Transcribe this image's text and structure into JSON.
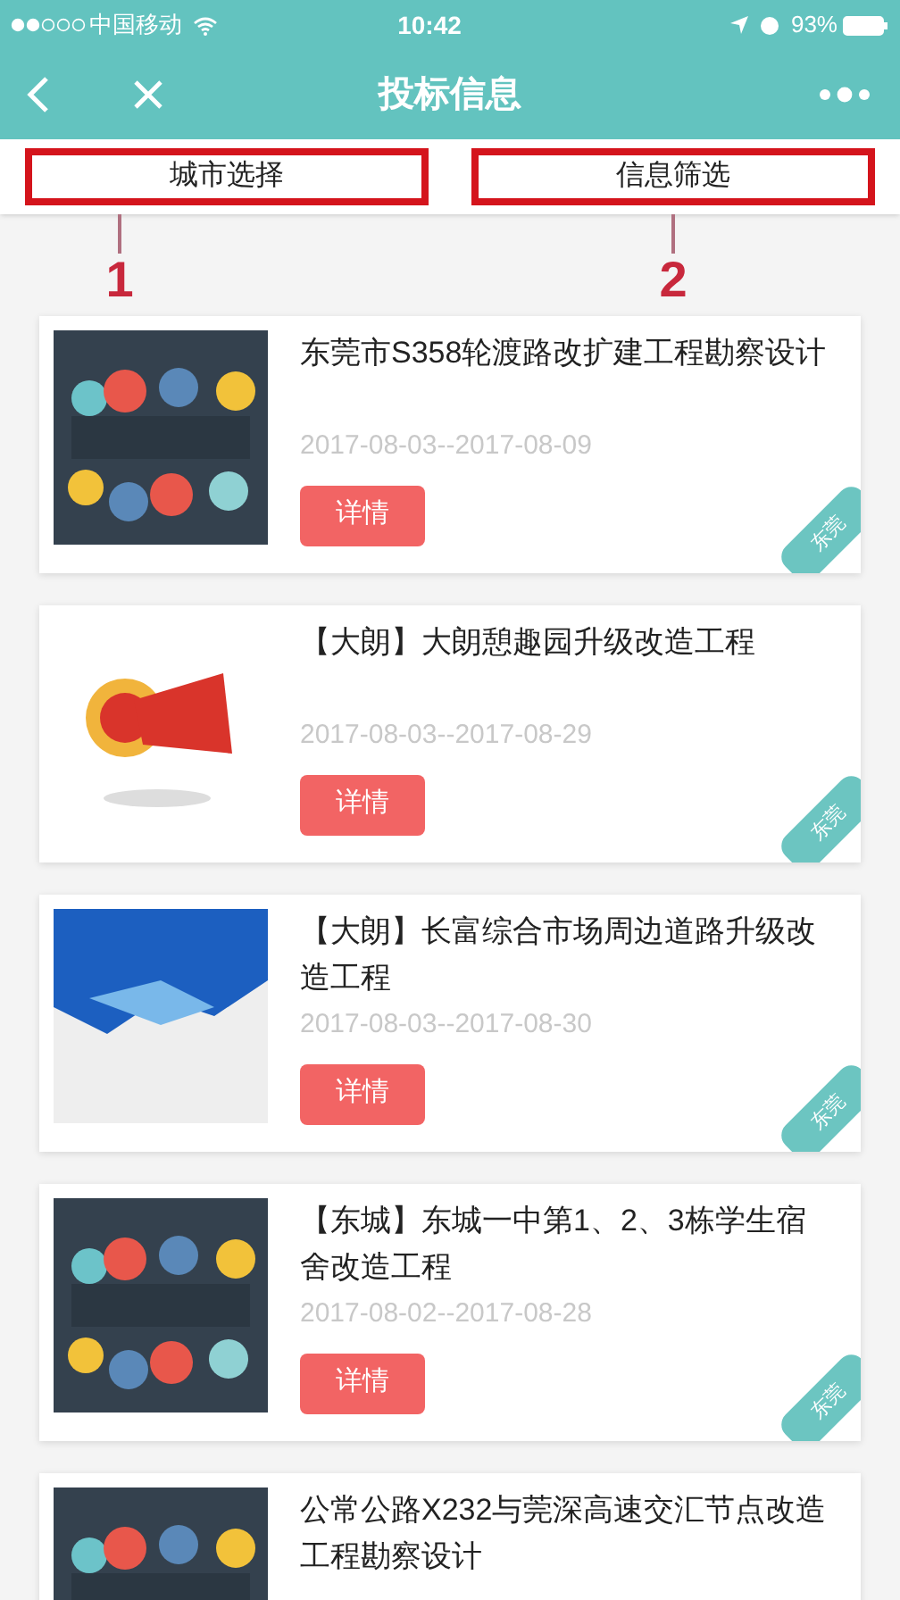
{
  "status_bar": {
    "carrier": "中国移动",
    "time": "10:42",
    "battery": "93%"
  },
  "nav": {
    "title": "投标信息"
  },
  "filters": [
    {
      "label": "城市选择",
      "number": "1"
    },
    {
      "label": "信息筛选",
      "number": "2"
    }
  ],
  "items": [
    {
      "kind": "festive",
      "title": "东莞市S358轮渡路改扩建工程勘察设计",
      "dates": "2017-08-03--2017-08-09",
      "button": "详情",
      "tag": "东莞"
    },
    {
      "kind": "megaphone",
      "title": "【大朗】大朗憩趣园升级改造工程",
      "dates": "2017-08-03--2017-08-29",
      "button": "详情",
      "tag": "东莞"
    },
    {
      "kind": "blue",
      "title": "【大朗】长富综合市场周边道路升级改造工程",
      "dates": "2017-08-03--2017-08-30",
      "button": "详情",
      "tag": "东莞"
    },
    {
      "kind": "festive",
      "title": "【东城】东城一中第1、2、3栋学生宿舍改造工程",
      "dates": "2017-08-02--2017-08-28",
      "button": "详情",
      "tag": "东莞"
    },
    {
      "kind": "festive",
      "title": "公常公路X232与莞深高速交汇节点改造工程勘察设计"
    }
  ]
}
